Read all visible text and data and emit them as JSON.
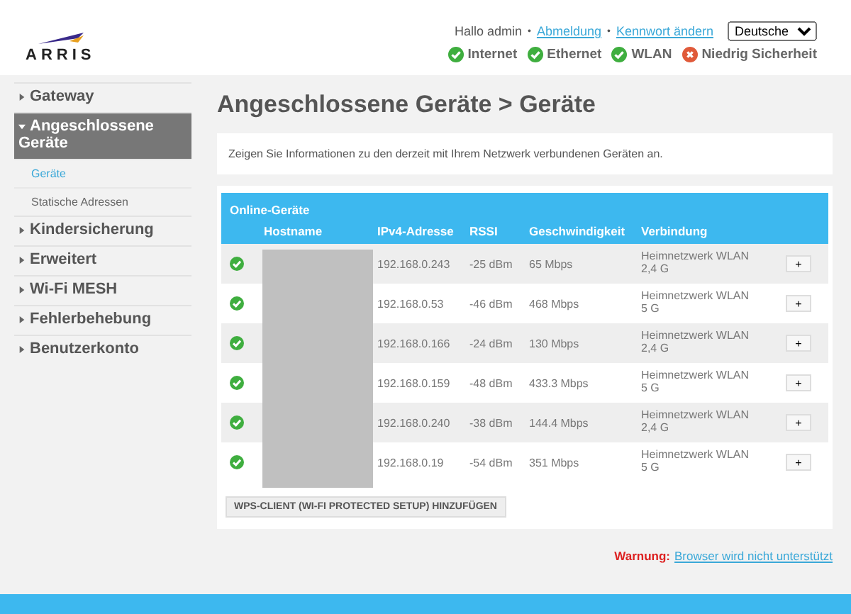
{
  "header": {
    "logo": "ARRIS",
    "greeting": "Hallo admin",
    "separator": "•",
    "links": [
      "Abmeldung",
      "Kennwort ändern"
    ],
    "language": "Deutsche",
    "status": [
      {
        "label": "Internet",
        "ok": true
      },
      {
        "label": "Ethernet",
        "ok": true
      },
      {
        "label": "WLAN",
        "ok": true
      },
      {
        "label": "Niedrig Sicherheit",
        "ok": false
      }
    ]
  },
  "sidebar": {
    "items": [
      {
        "label": "Gateway",
        "expanded": false,
        "selected": false
      },
      {
        "label": "Angeschlossene Geräte",
        "expanded": true,
        "selected": true,
        "children": [
          {
            "label": "Geräte",
            "selected": true
          },
          {
            "label": "Statische Adressen",
            "selected": false
          }
        ]
      },
      {
        "label": "Kindersicherung",
        "expanded": false,
        "selected": false
      },
      {
        "label": "Erweitert",
        "expanded": false,
        "selected": false
      },
      {
        "label": "Wi-Fi MESH",
        "expanded": false,
        "selected": false
      },
      {
        "label": "Fehlerbehebung",
        "expanded": false,
        "selected": false
      },
      {
        "label": "Benutzerkonto",
        "expanded": false,
        "selected": false
      }
    ]
  },
  "page_title": "Angeschlossene Geräte > Geräte",
  "description": "Zeigen Sie Informationen zu den derzeit mit Ihrem Netzwerk verbundenen Geräten an.",
  "table": {
    "title": "Online-Geräte",
    "columns": [
      "Hostname",
      "IPv4-Adresse",
      "RSSI",
      "Geschwindigkeit",
      "Verbindung"
    ],
    "rows": [
      {
        "online": true,
        "ip": "192.168.0.243",
        "rssi": "-25 dBm",
        "speed": "65 Mbps",
        "connection": [
          "Heimnetzwerk WLAN",
          "2,4 G"
        ],
        "action": "+"
      },
      {
        "online": true,
        "ip": "192.168.0.53",
        "rssi": "-46 dBm",
        "speed": "468 Mbps",
        "connection": [
          "Heimnetzwerk WLAN",
          "5 G"
        ],
        "action": "+"
      },
      {
        "online": true,
        "ip": "192.168.0.166",
        "rssi": "-24 dBm",
        "speed": "130 Mbps",
        "connection": [
          "Heimnetzwerk WLAN",
          "2,4 G"
        ],
        "action": "+"
      },
      {
        "online": true,
        "ip": "192.168.0.159",
        "rssi": "-48 dBm",
        "speed": "433.3 Mbps",
        "connection": [
          "Heimnetzwerk WLAN",
          "5 G"
        ],
        "action": "+"
      },
      {
        "online": true,
        "ip": "192.168.0.240",
        "rssi": "-38 dBm",
        "speed": "144.4 Mbps",
        "connection": [
          "Heimnetzwerk WLAN",
          "2,4 G"
        ],
        "action": "+"
      },
      {
        "online": true,
        "ip": "192.168.0.19",
        "rssi": "-54 dBm",
        "speed": "351 Mbps",
        "connection": [
          "Heimnetzwerk WLAN",
          "5 G"
        ],
        "action": "+"
      }
    ]
  },
  "wps_button": "WPS-CLIENT (WI-FI PROTECTED SETUP) HINZUFÜGEN",
  "warning": {
    "label": "Warnung:",
    "link": "Browser wird nicht unterstützt"
  }
}
